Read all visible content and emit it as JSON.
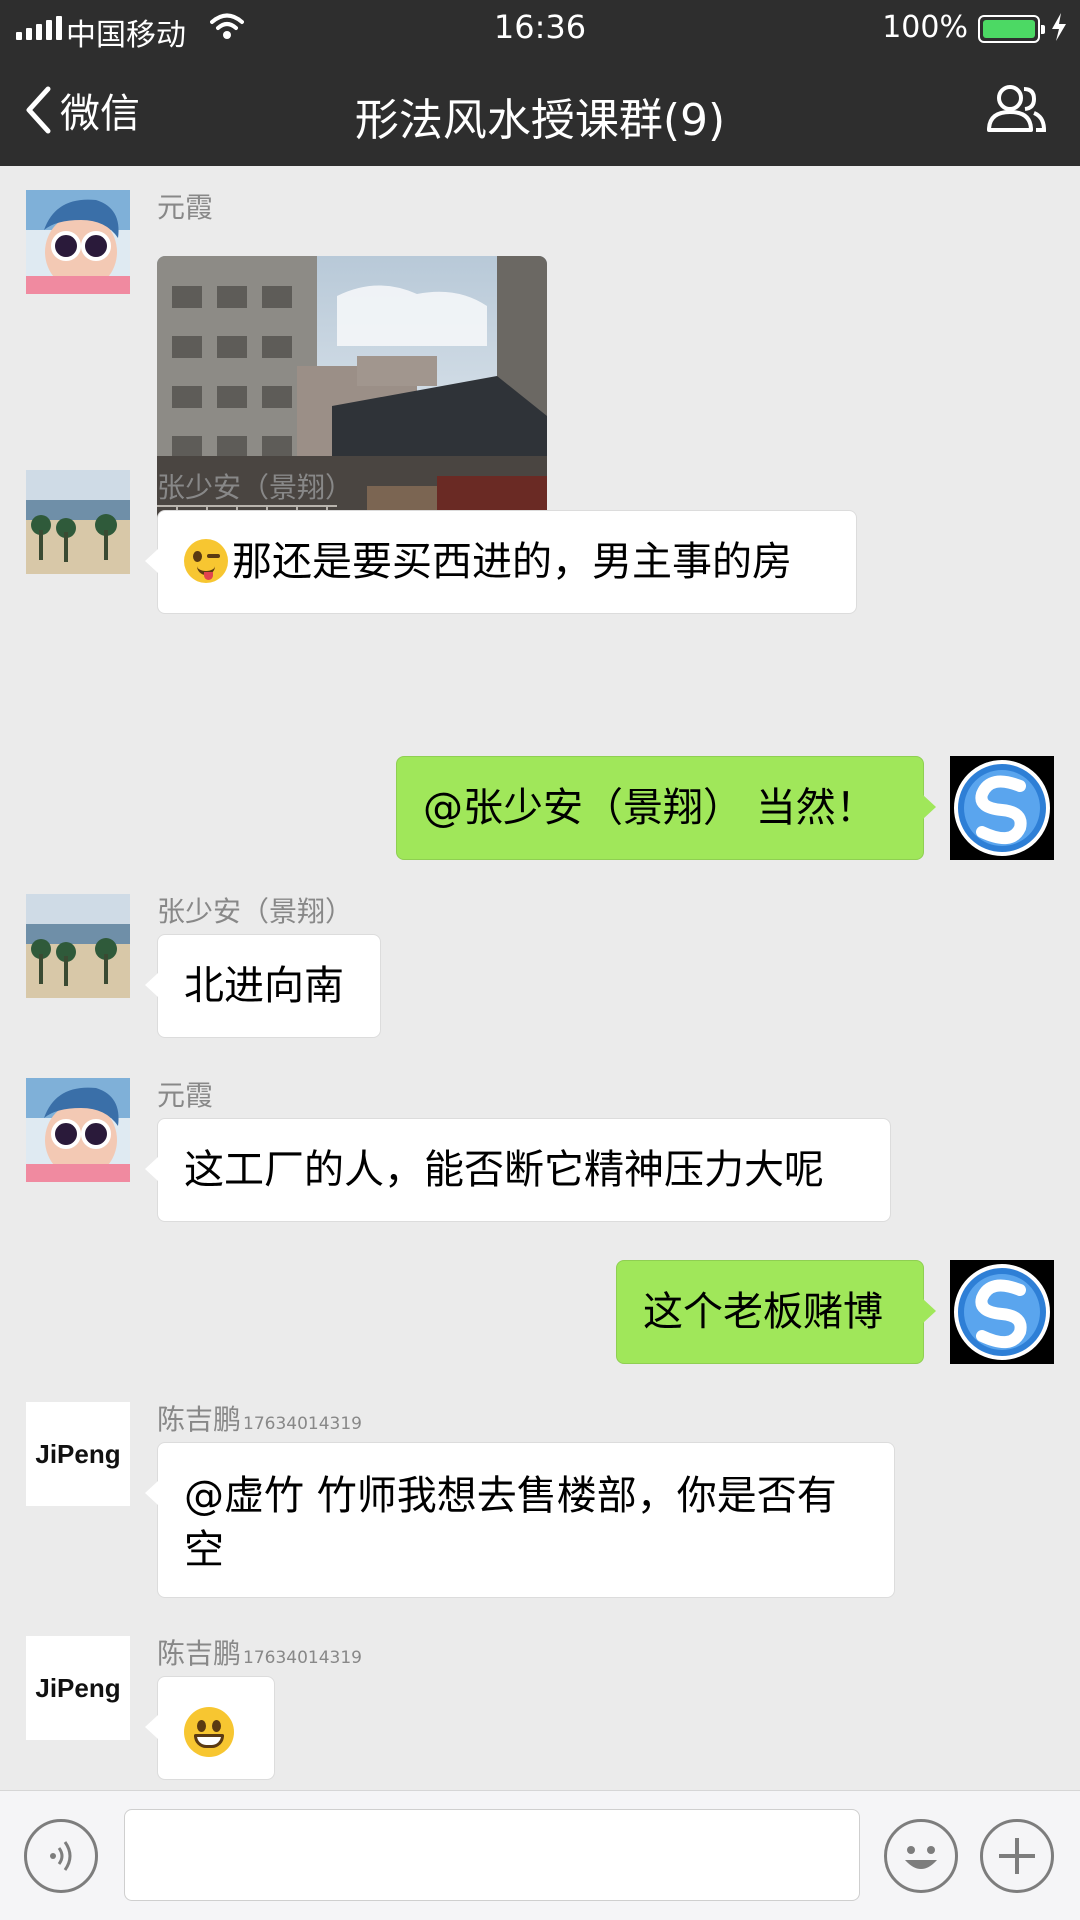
{
  "status_bar": {
    "carrier": "中国移动",
    "time": "16:36",
    "battery": "100%"
  },
  "nav": {
    "back_label": "微信",
    "title": "形法风水授课群(9)"
  },
  "messages": [
    {
      "sender": "元霞",
      "type": "image"
    },
    {
      "sender": "张少安（景翔）",
      "text": "那还是要买西进的，男主事的房"
    },
    {
      "sender": "self",
      "text": "@张少安（景翔） 当然！"
    },
    {
      "sender": "张少安（景翔）",
      "text": "北进向南"
    },
    {
      "sender": "元霞",
      "text": "这工厂的人，能否断它精神压力大呢"
    },
    {
      "sender": "self",
      "text": "这个老板赌博"
    },
    {
      "sender": "陈吉鹏",
      "sender_phone": "17634014319",
      "text": "@虚竹 竹师我想去售楼部，你是否有空"
    },
    {
      "sender": "陈吉鹏",
      "sender_phone": "17634014319",
      "type": "emoji"
    }
  ],
  "avatars": {
    "jipeng_logo": "JiPeng"
  },
  "icons": {
    "back": "chevron-left-icon",
    "members": "group-icon",
    "voice": "voice-icon",
    "emoji": "emoji-icon",
    "plus": "plus-icon"
  },
  "colors": {
    "nav_bg": "#2e2e2e",
    "chat_bg": "#ebebeb",
    "bubble_out": "#a0e75a",
    "bubble_in": "#ffffff"
  }
}
